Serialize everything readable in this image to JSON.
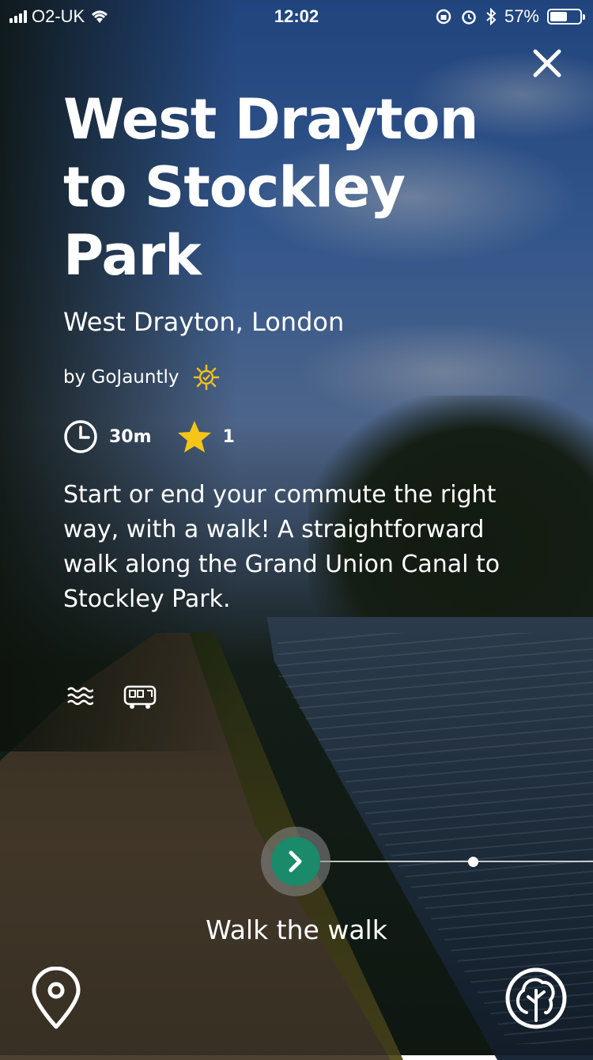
{
  "status_bar": {
    "carrier": "O2-UK",
    "time": "12:02",
    "battery": "57%",
    "battery_level": 0.57
  },
  "walk": {
    "title": "West Drayton to Stockley Park",
    "location": "West Drayton, London",
    "author": "by GoJauntly",
    "duration": "30m",
    "rating": "1",
    "description": "Start or end your commute the right way, with a walk! A straightforward walk along the Grand Union Canal to Stockley Park.",
    "tags": [
      "water-waves-icon",
      "train-icon"
    ]
  },
  "cta": {
    "label": "Walk the walk"
  },
  "colors": {
    "accent": "#1a8a6a",
    "star": "#f5c518",
    "sun": "#f0c020"
  },
  "icons": {
    "close": "close-icon",
    "map": "map-pin-icon",
    "tree": "tree-icon",
    "clock": "clock-icon",
    "star": "star-icon",
    "sun": "sun-icon",
    "arrow": "chevron-right-icon"
  }
}
